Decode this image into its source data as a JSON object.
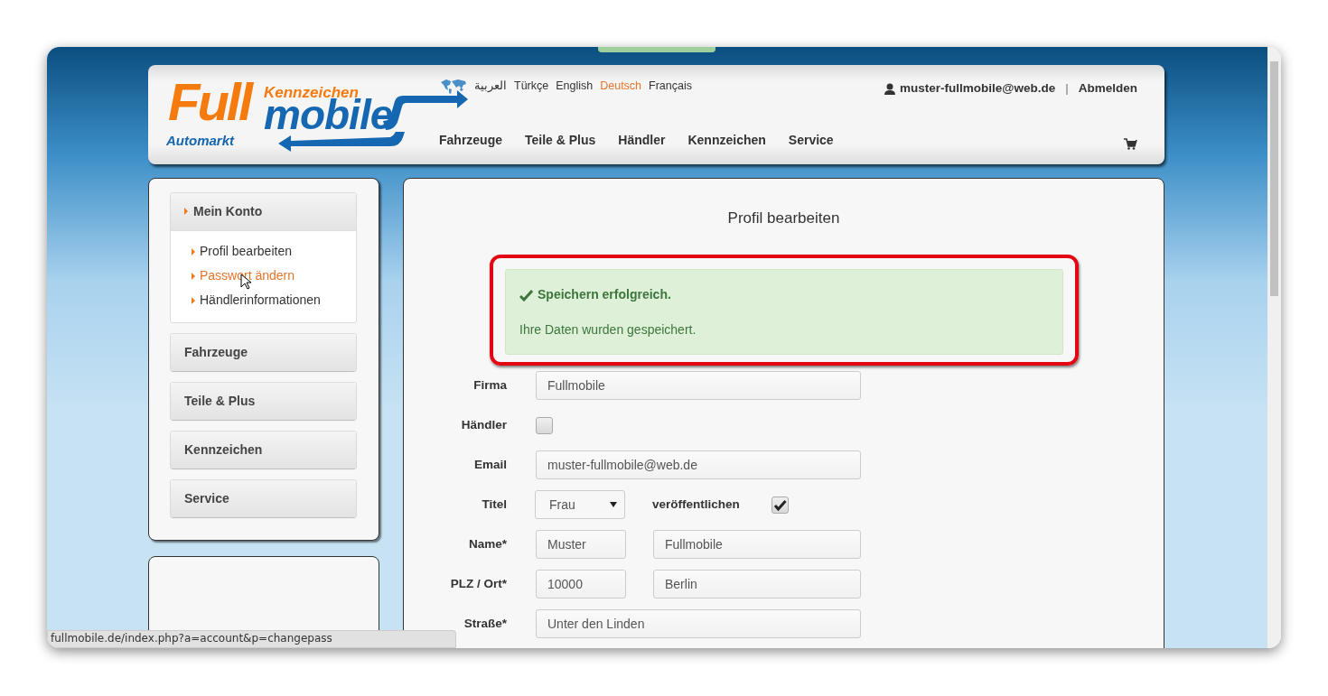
{
  "header": {
    "logo": {
      "word_1": "Full",
      "word_2": "mobile",
      "tagline_top": "Kennzeichen",
      "tagline_bottom": "Automarkt"
    },
    "languages": [
      {
        "label": "العربية",
        "selected": false
      },
      {
        "label": "Türkçe",
        "selected": false
      },
      {
        "label": "English",
        "selected": false
      },
      {
        "label": "Deutsch",
        "selected": true
      },
      {
        "label": "Français",
        "selected": false
      }
    ],
    "user_email": "muster-fullmobile@web.de",
    "separator": "|",
    "logout": "Abmelden",
    "nav": [
      "Fahrzeuge",
      "Teile & Plus",
      "Händler",
      "Kennzeichen",
      "Service"
    ]
  },
  "sidebar": {
    "sections": [
      {
        "label": "Mein Konto",
        "expanded": true,
        "children": [
          {
            "label": "Profil bearbeiten",
            "hovered": false
          },
          {
            "label": "Passwort ändern",
            "hovered": true
          },
          {
            "label": "Händlerinformationen",
            "hovered": false
          }
        ]
      },
      {
        "label": "Fahrzeuge",
        "expanded": false
      },
      {
        "label": "Teile & Plus",
        "expanded": false
      },
      {
        "label": "Kennzeichen",
        "expanded": false
      },
      {
        "label": "Service",
        "expanded": false
      }
    ]
  },
  "main": {
    "title": "Profil bearbeiten",
    "alert": {
      "title": "Speichern erfolgreich.",
      "message": "Ihre Daten wurden gespeichert.",
      "highlighted": true
    },
    "form": [
      {
        "kind": "text",
        "label": "Firma",
        "value": "Fullmobile"
      },
      {
        "kind": "checkbox",
        "label": "Händler",
        "checked": false
      },
      {
        "kind": "text",
        "label": "Email",
        "value": "muster-fullmobile@web.de"
      },
      {
        "kind": "select",
        "label": "Titel",
        "value": "Frau",
        "extra_label": "veröffentlichen",
        "checked": true
      },
      {
        "kind": "pair",
        "label": "Name*",
        "value": "Muster",
        "value_2": "Fullmobile"
      },
      {
        "kind": "pair",
        "label": "PLZ / Ort*",
        "value": "10000",
        "value_2": "Berlin"
      },
      {
        "kind": "text",
        "label": "Straße*",
        "value": "Unter den Linden"
      }
    ]
  },
  "status_bar": "fullmobile.de/index.php?a=account&p=changepass"
}
